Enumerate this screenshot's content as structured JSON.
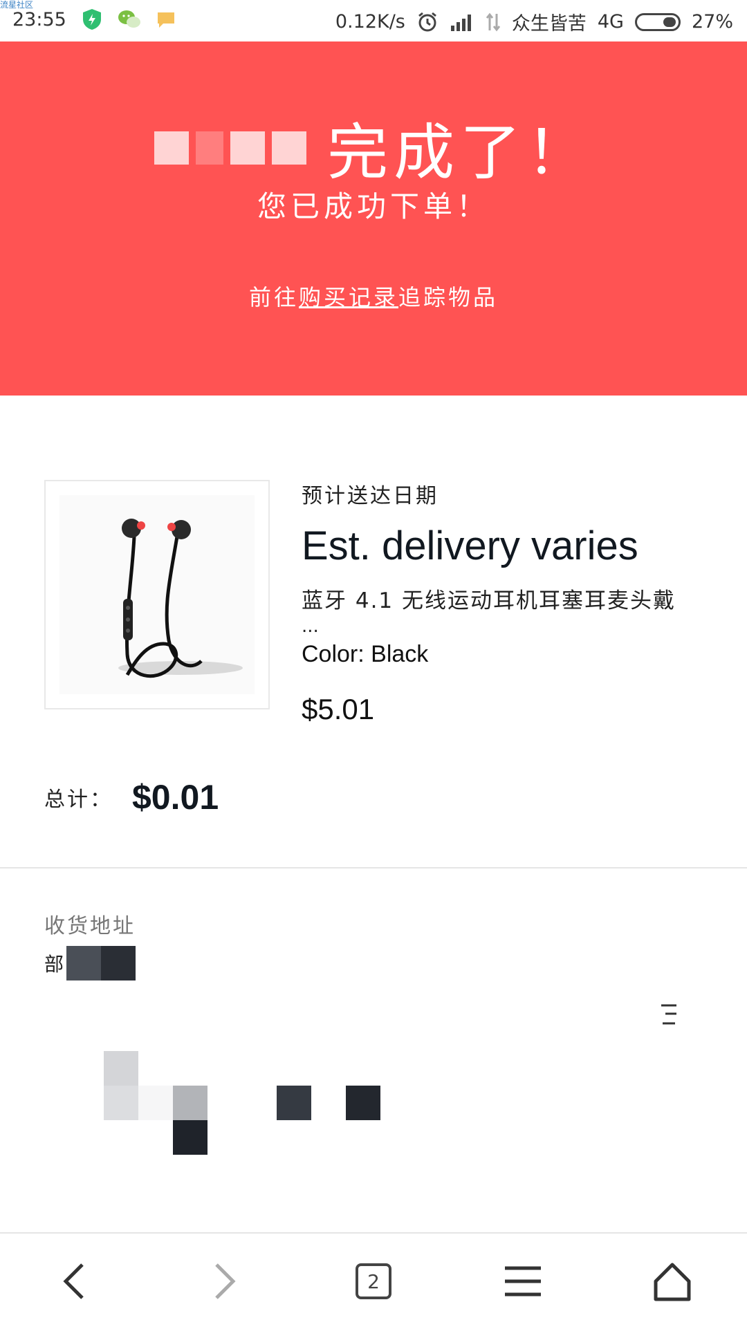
{
  "status_bar": {
    "corner_tag": "流星社区",
    "time": "23:55",
    "net_speed": "0.12K/s",
    "carrier": "众生皆苦",
    "network": "4G",
    "battery": "27%",
    "battery_level": 0.27,
    "icons": [
      "shield-icon",
      "wechat-icon",
      "message-icon",
      "alarm-icon",
      "signal-icon",
      "data-arrows-icon"
    ]
  },
  "hero": {
    "title": "完成了！",
    "subtitle": "您已成功下单！",
    "link_prefix": "前往",
    "link_text": "购买记录",
    "link_suffix": "追踪物品",
    "color": "#ff5353"
  },
  "order": {
    "delivery_label": "预计送达日期",
    "delivery_value": "Est. delivery varies",
    "item_title": "蓝牙 4.1 无线运动耳机耳塞耳麦头戴",
    "item_ellipsis": "...",
    "item_color": "Color: Black",
    "item_price": "$5.01",
    "total_label": "总计：",
    "total_value": "$0.01"
  },
  "address": {
    "label": "收货地址",
    "name_prefix": "部"
  },
  "bottom_nav": {
    "tab_count": "2",
    "icons": [
      "back-icon",
      "forward-icon",
      "tabs-icon",
      "menu-icon",
      "home-icon"
    ]
  }
}
